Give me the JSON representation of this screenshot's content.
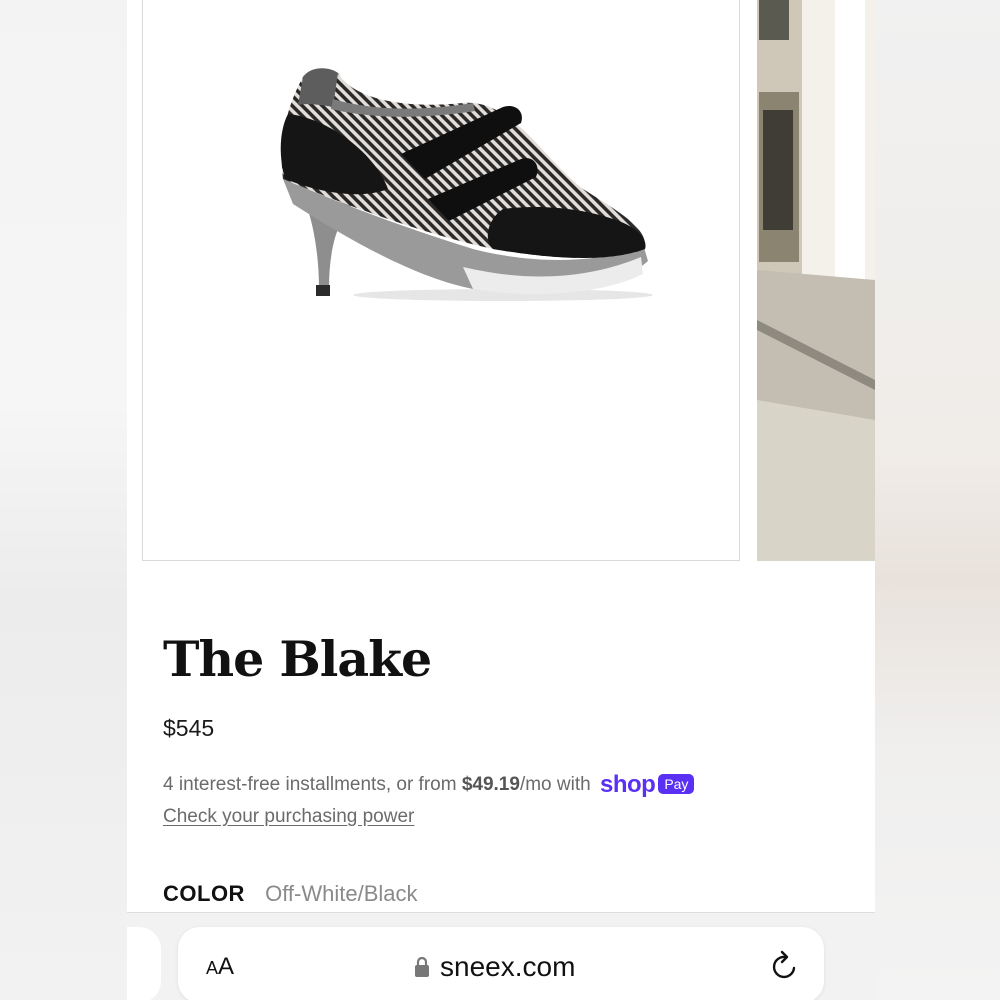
{
  "product": {
    "title": "The Blake",
    "price": "$545",
    "installments_prefix": "4 interest-free installments, or from ",
    "installment_amount": "$49.19",
    "installments_suffix": "/mo with",
    "shop_pay_word": "shop",
    "shop_pay_badge": "Pay",
    "purchasing_power_link": "Check your purchasing power",
    "color_label": "COLOR",
    "color_value": "Off-White/Black"
  },
  "browser": {
    "text_size_button": "AA",
    "url": "sneex.com"
  },
  "icons": {
    "lock": "lock-icon",
    "reload": "reload-icon"
  },
  "colors": {
    "shop_pay": "#5a31f4"
  }
}
